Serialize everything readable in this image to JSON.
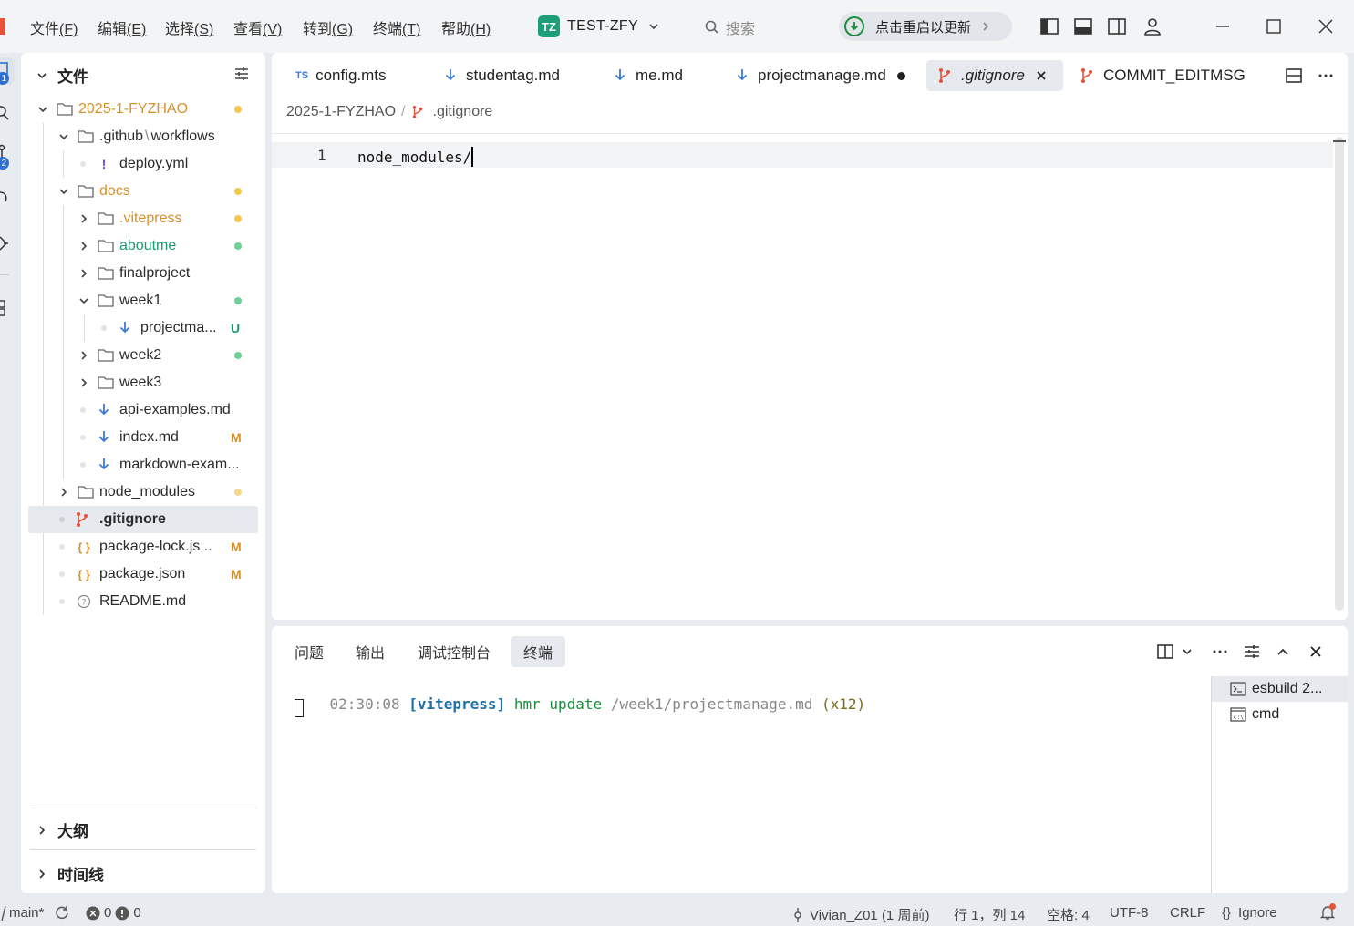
{
  "titlebar": {
    "menu": [
      {
        "text": "文件",
        "key": "(F)"
      },
      {
        "text": "编辑",
        "key": "(E)"
      },
      {
        "text": "选择",
        "key": "(S)"
      },
      {
        "text": "查看",
        "key": "(V)"
      },
      {
        "text": "转到",
        "key": "(G)"
      },
      {
        "text": "终端",
        "key": "(T)"
      },
      {
        "text": "帮助",
        "key": "(H)"
      }
    ],
    "project_badge": "TZ",
    "project_name": "TEST-ZFY",
    "search_placeholder": "搜索",
    "update_label": "点击重启以更新"
  },
  "activitybar": {
    "explorer_badge": "1",
    "scm_badge": "2"
  },
  "sidebar": {
    "title": "文件",
    "tree": [
      {
        "label": "2025-1-FYZHAO",
        "color": "#d4922c",
        "status": "dot-yellow"
      },
      {
        "label_a": ".github",
        "label_sep": "\\",
        "label_b": "workflows"
      },
      {
        "label": "deploy.yml"
      },
      {
        "label": "docs",
        "color": "#d4922c",
        "status": "dot-yellow"
      },
      {
        "label": ".vitepress",
        "color": "#d4922c",
        "status": "dot-yellow"
      },
      {
        "label": "aboutme",
        "color": "#1a9b73",
        "status": "dot-green"
      },
      {
        "label": "finalproject"
      },
      {
        "label": "week1",
        "status": "dot-green"
      },
      {
        "label": "projectma...",
        "badge": "U",
        "badge_color": "#1a9b73"
      },
      {
        "label": "week2",
        "status": "dot-green"
      },
      {
        "label": "week3"
      },
      {
        "label": "api-examples.md"
      },
      {
        "label": "index.md",
        "badge": "M",
        "badge_color": "#d4922c"
      },
      {
        "label": "markdown-exam..."
      },
      {
        "label": "node_modules",
        "status": "dot-yellow"
      },
      {
        "label": ".gitignore"
      },
      {
        "label": "package-lock.js...",
        "badge": "M",
        "badge_color": "#d4922c"
      },
      {
        "label": "package.json",
        "badge": "M",
        "badge_color": "#d4922c"
      },
      {
        "label": "README.md"
      }
    ],
    "outline_label": "大纲",
    "timeline_label": "时间线"
  },
  "editor": {
    "tabs": [
      {
        "icon": "TS",
        "label": "config.mts"
      },
      {
        "label": "studentag.md"
      },
      {
        "label": "me.md"
      },
      {
        "label": "projectmanage.md",
        "modified": true
      },
      {
        "label": ".gitignore",
        "active": true
      },
      {
        "label": "COMMIT_EDITMSG"
      }
    ],
    "breadcrumb": [
      "2025-1-FYZHAO",
      ".gitignore"
    ],
    "breadcrumb_sep": "/",
    "lines": [
      {
        "number": "1",
        "text": "node_modules/"
      }
    ]
  },
  "panel": {
    "tabs": [
      "问题",
      "输出",
      "调试控制台",
      "终端"
    ],
    "active_tab": "终端",
    "terminal": {
      "time": "02:30:08",
      "tag": "[vitepress]",
      "msg": "hmr update",
      "path": "/week1/projectmanage.md",
      "count": "(x12)"
    },
    "terminals": [
      "esbuild 2...",
      "cmd"
    ]
  },
  "statusbar": {
    "branch": "main*",
    "errors": "0",
    "warnings": "0",
    "blame": "Vivian_Z01 (1 周前)",
    "position": "行 1，列 14",
    "spaces": "空格: 4",
    "encoding": "UTF-8",
    "eol": "CRLF",
    "language": "Ignore"
  },
  "colors": {
    "accent_green": "#1e9d79",
    "git_orange": "#d4922c",
    "git_green": "#1a9b73",
    "gitignore_red": "#e5533c",
    "md_blue": "#3b7bd9"
  }
}
